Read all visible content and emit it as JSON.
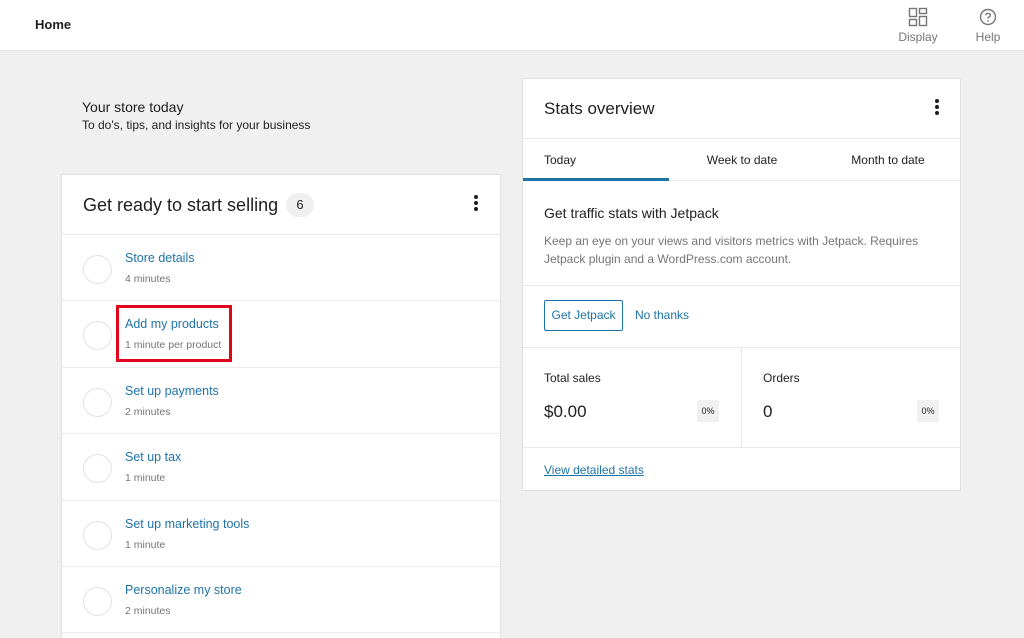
{
  "header": {
    "title": "Home",
    "display_label": "Display",
    "help_label": "Help"
  },
  "intro": {
    "heading": "Your store today",
    "subheading": "To do's, tips, and insights for your business"
  },
  "tasks": {
    "title": "Get ready to start selling",
    "count": "6",
    "items": [
      {
        "title": "Store details",
        "time": "4 minutes"
      },
      {
        "title": "Add my products",
        "time": "1 minute per product"
      },
      {
        "title": "Set up payments",
        "time": "2 minutes"
      },
      {
        "title": "Set up tax",
        "time": "1 minute"
      },
      {
        "title": "Set up marketing tools",
        "time": "1 minute"
      },
      {
        "title": "Personalize my store",
        "time": "2 minutes"
      }
    ]
  },
  "stats": {
    "title": "Stats overview",
    "tabs": [
      "Today",
      "Week to date",
      "Month to date"
    ],
    "jetpack": {
      "title": "Get traffic stats with Jetpack",
      "description": "Keep an eye on your views and visitors metrics with Jetpack. Requires Jetpack plugin and a WordPress.com account.",
      "get_label": "Get Jetpack",
      "dismiss_label": "No thanks"
    },
    "metrics": [
      {
        "label": "Total sales",
        "value": "$0.00",
        "delta": "0%"
      },
      {
        "label": "Orders",
        "value": "0",
        "delta": "0%"
      }
    ],
    "view_link": "View detailed stats"
  },
  "colors": {
    "accent": "#1e73a8",
    "highlight": "#e1061b",
    "background": "#f0f0f1"
  }
}
